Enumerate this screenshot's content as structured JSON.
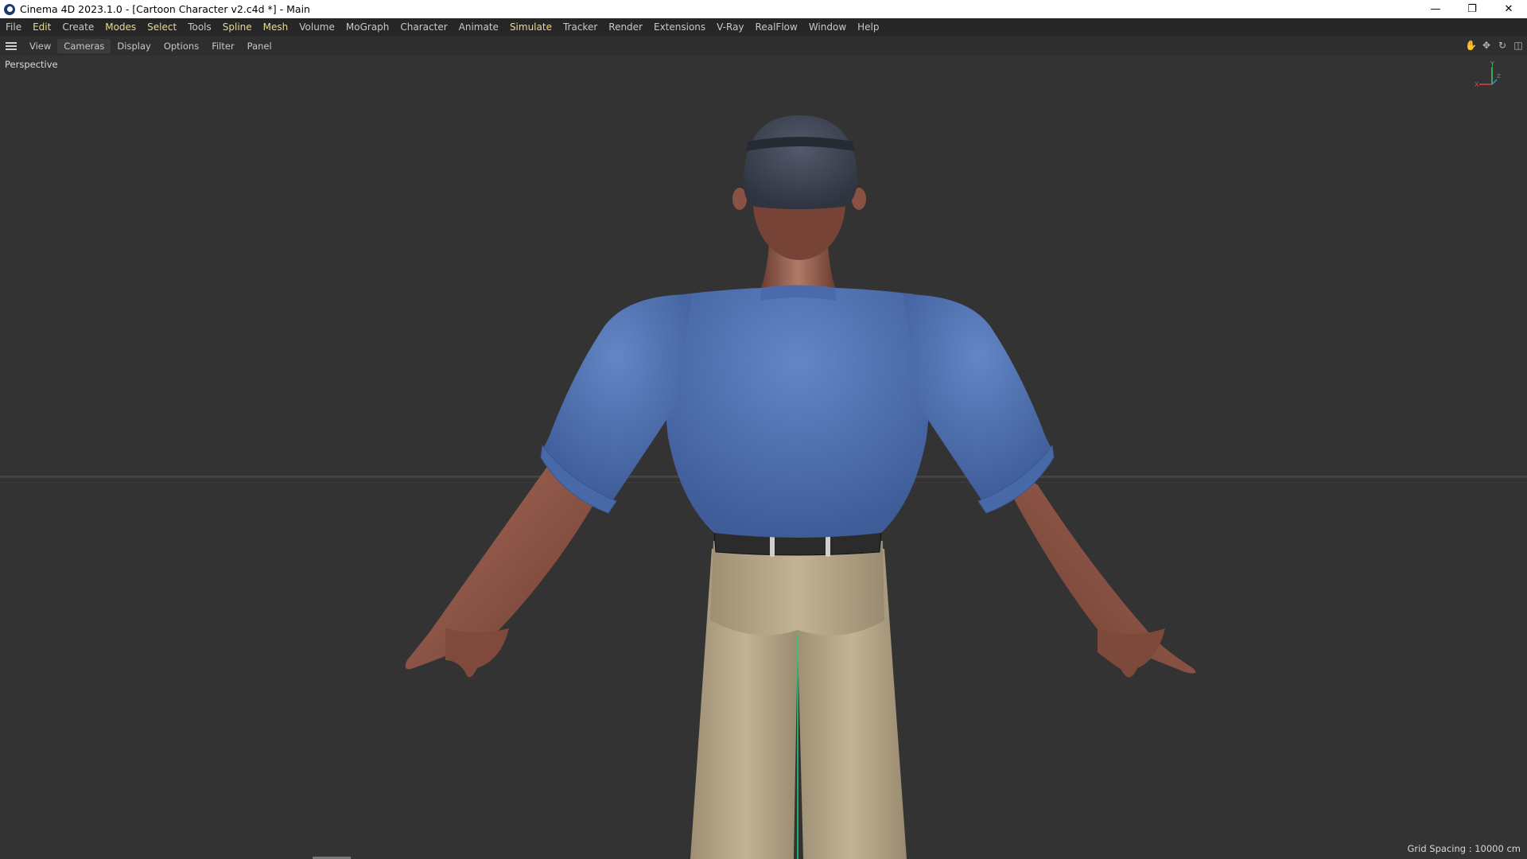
{
  "window": {
    "title": "Cinema 4D 2023.1.0 - [Cartoon Character v2.c4d *] - Main",
    "controls": {
      "minimize": "—",
      "restore": "❐",
      "close": "✕"
    }
  },
  "menubar": {
    "items": [
      {
        "label": "File",
        "highlight": false
      },
      {
        "label": "Edit",
        "highlight": true
      },
      {
        "label": "Create",
        "highlight": false
      },
      {
        "label": "Modes",
        "highlight": true
      },
      {
        "label": "Select",
        "highlight": true
      },
      {
        "label": "Tools",
        "highlight": false
      },
      {
        "label": "Spline",
        "highlight": true
      },
      {
        "label": "Mesh",
        "highlight": true
      },
      {
        "label": "Volume",
        "highlight": false
      },
      {
        "label": "MoGraph",
        "highlight": false
      },
      {
        "label": "Character",
        "highlight": false
      },
      {
        "label": "Animate",
        "highlight": false
      },
      {
        "label": "Simulate",
        "highlight": true
      },
      {
        "label": "Tracker",
        "highlight": false
      },
      {
        "label": "Render",
        "highlight": false
      },
      {
        "label": "Extensions",
        "highlight": false
      },
      {
        "label": "V-Ray",
        "highlight": false
      },
      {
        "label": "RealFlow",
        "highlight": false
      },
      {
        "label": "Window",
        "highlight": false
      },
      {
        "label": "Help",
        "highlight": false
      }
    ]
  },
  "viewport_menu": {
    "items": [
      "View",
      "Cameras",
      "Display",
      "Options",
      "Filter",
      "Panel"
    ],
    "active": "Cameras"
  },
  "viewport": {
    "label": "Perspective",
    "grid_info": "Grid Spacing : 10000 cm",
    "axis": {
      "x": "X",
      "y": "Y",
      "z": "Z"
    }
  },
  "colors": {
    "shirt": "#4f6fae",
    "skin": "#8a5243",
    "pants": "#b3a385",
    "hat": "#3a3f4c",
    "belt": "#2b2b2b",
    "background": "#333333"
  }
}
